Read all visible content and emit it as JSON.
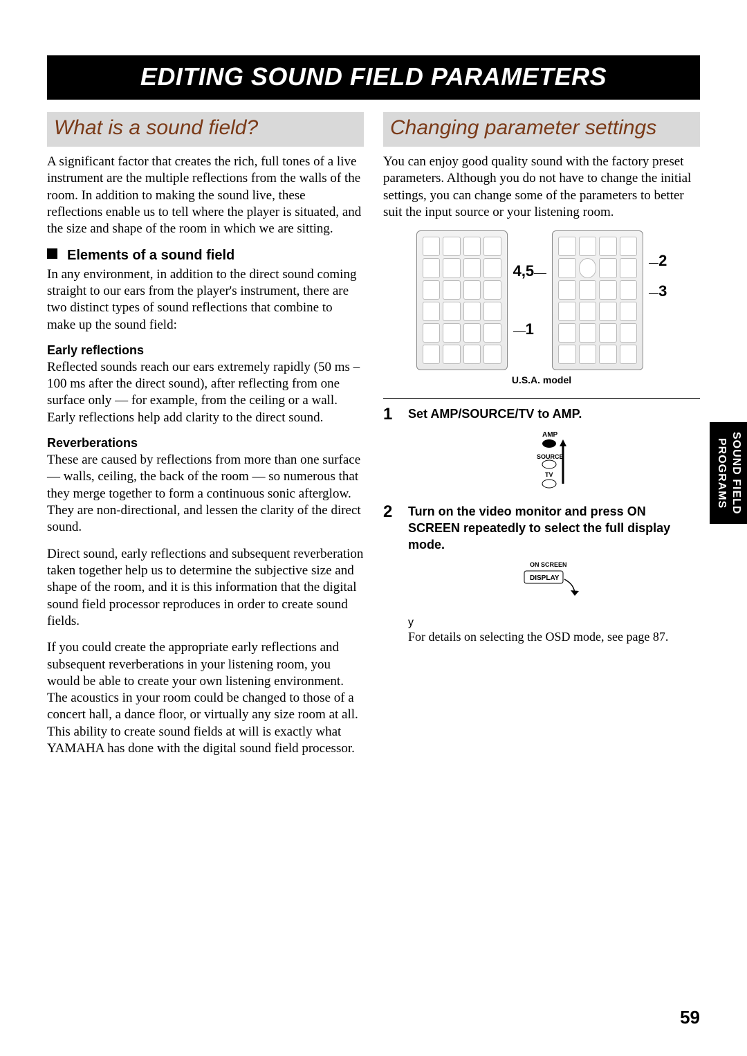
{
  "banner": "EDITING SOUND FIELD PARAMETERS",
  "side_tab": {
    "line1": "SOUND FIELD",
    "line2": "PROGRAMS"
  },
  "page_number": "59",
  "left": {
    "header": "What is a sound field?",
    "intro": "A significant factor that creates the rich, full tones of a live instrument are the multiple reflections from the walls of the room. In addition to making the sound live, these reflections enable us to tell where the player is situated, and the size and shape of the room in which we are sitting.",
    "sub1": "Elements of a sound field",
    "sub1_body": "In any environment, in addition to the direct sound coming straight to our ears from the player's instrument, there are two distinct types of sound reflections that combine to make up the sound field:",
    "early_h": "Early reflections",
    "early_body": "Reflected sounds reach our ears extremely rapidly (50 ms – 100 ms after the direct sound), after reflecting from one surface only — for example, from the ceiling or a wall. Early reflections help add clarity to the direct sound.",
    "reverb_h": "Reverberations",
    "reverb_body": "These are caused by reflections from more than one surface — walls, ceiling, the back of the room — so numerous that they merge together to form a continuous sonic afterglow. They are non-directional, and lessen the clarity of the direct sound.",
    "para3": "Direct sound, early reflections and subsequent reverberation taken together help us to determine the subjective size and shape of the room, and it is this information that the digital sound field processor reproduces in order to create sound fields.",
    "para4": "If you could create the appropriate early reflections and subsequent reverberations in your listening room, you would be able to create your own listening environment. The acoustics in your room could be changed to those of a concert hall, a dance floor, or virtually any size room at all. This ability to create sound fields at will is exactly what YAMAHA has done with the digital sound field processor."
  },
  "right": {
    "header": "Changing parameter settings",
    "intro": "You can enjoy good quality sound with the factory preset parameters. Although you do not have to change the initial settings, you can change some of the parameters to better suit the input source or your listening room.",
    "callouts": {
      "c45": "4,5",
      "c2": "2",
      "c3": "3",
      "c1": "1"
    },
    "model_caption": "U.S.A. model",
    "step1": {
      "num": "1",
      "text": "Set AMP/SOURCE/TV to AMP."
    },
    "switch_labels": {
      "amp": "AMP",
      "source": "SOURCE",
      "tv": "TV"
    },
    "step2": {
      "num": "2",
      "text": "Turn on the video monitor and press ON SCREEN repeatedly to select the full display mode."
    },
    "onscreen": {
      "top": "ON SCREEN",
      "btn": "DISPLAY"
    },
    "footnote_marker": "y",
    "footnote_body": "For details on selecting the OSD mode, see page 87."
  }
}
